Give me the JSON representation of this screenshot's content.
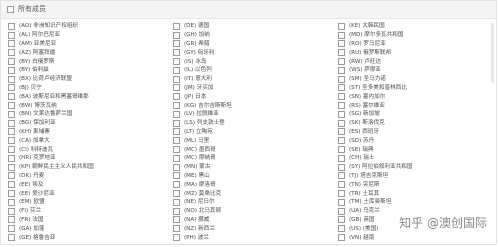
{
  "header": {
    "title": "所有成员"
  },
  "columns": [
    [
      "(AO) 非洲知识产权组织",
      "(AL) 阿尔巴尼亚",
      "(AM) 亚美尼亚",
      "(AZ) 阿塞拜疆",
      "(BY) 白俄罗斯",
      "(BY) 伯利兹",
      "(BX) 比荷卢经济联盟",
      "(BJ) 贝宁",
      "(BA) 波斯尼亚和黑塞哥维那",
      "(BW) 博茨瓦纳",
      "(BN) 文莱达鲁萨兰国",
      "(BG) 保加利亚",
      "(KH) 柬埔寨",
      "(CA) 加拿大",
      "(CI) 科特迪瓦",
      "(HR) 克罗地亚",
      "(KP) 朝鲜民主主义人民共和国",
      "(DK) 丹麦",
      "(EE) 埃及",
      "(EE) 爱沙尼亚",
      "(EM) 欧盟",
      "(FI) 芬兰",
      "(FR) 法国",
      "(GA) 加蓬",
      "(GE) 格鲁吉亚"
    ],
    [
      "(DE) 德国",
      "(GH) 加纳",
      "(GR) 希腊",
      "(GY) 匈牙利",
      "(IS) 冰岛",
      "(IL) 以色列",
      "(IT) 意大利",
      "(JM) 牙买加",
      "(JP) 日本",
      "(KG) 吉尔吉斯斯坦",
      "(LV) 拉脱维亚",
      "(LS) 列支敦士登",
      "(LT) 立陶宛",
      "(ML) 马里",
      "(MC) 墨西哥",
      "(MC) 摩纳哥",
      "(MN) 蒙古",
      "(ME) 黑山",
      "(MA) 摩洛哥",
      "(MZ) 莫桑比克",
      "(NE) 尼日尔",
      "(NO) 北马其顿",
      "(NA) 挪威",
      "(NZ) 新西兰",
      "(PH) 波兰"
    ],
    [
      "(KE) 大韩民国",
      "(MD) 摩尔多瓦共和国",
      "(RO) 罗马尼亚",
      "(RU) 俄罗斯联邦",
      "(RW) 卢旺达",
      "(WS) 萨摩亚",
      "(SM) 圣马力诺",
      "(ST) 圣多美和普林西比",
      "(SN) 塞内加尔",
      "(RS) 塞尔维亚",
      "(SG) 新加坡",
      "(SK) 斯洛伐克",
      "(ES) 西班牙",
      "(SD) 苏丹",
      "(SE) 瑞典",
      "(CH) 瑞士",
      "(SY) 阿拉伯叙利亚共和国",
      "(TJ) 塔吉克斯坦",
      "(TN) 突尼斯",
      "(TR) 土耳其",
      "(TM) 土库曼斯坦",
      "(UA) 乌克兰",
      "(GB) 英国",
      "(US) (美国)",
      "(VN) 越南"
    ]
  ],
  "watermark": {
    "text": "知乎 @澳创国际"
  }
}
